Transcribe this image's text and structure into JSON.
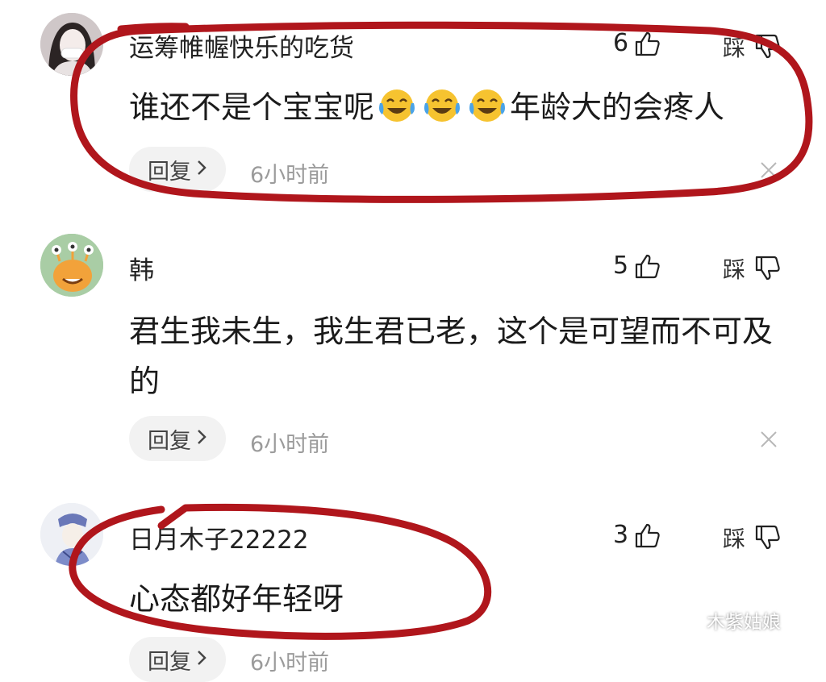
{
  "colors": {
    "annotation": "#b0161c",
    "muted_text": "#9b9b9b",
    "reply_bg": "#f2f2f2"
  },
  "comments": [
    {
      "username": "运筹帷幄快乐的吃货",
      "likes": "6",
      "dislike_label": "踩",
      "text_before": "谁还不是个宝宝呢",
      "emoji": [
        "crying-laughing-emoji",
        "crying-laughing-emoji",
        "crying-laughing-emoji"
      ],
      "text_after": "年龄大的会疼人",
      "reply_label": "回复",
      "time": "6小时前"
    },
    {
      "username": "韩",
      "likes": "5",
      "dislike_label": "踩",
      "text": "君生我未生，我生君已老，这个是可望而不可及的",
      "reply_label": "回复",
      "time": "6小时前"
    },
    {
      "username": "日月木子22222",
      "likes": "3",
      "dislike_label": "踩",
      "text": "心态都好年轻呀",
      "reply_label": "回复",
      "time": "6小时前"
    }
  ],
  "watermark": {
    "icon": "wechat-icon",
    "text": "木紫姑娘"
  }
}
